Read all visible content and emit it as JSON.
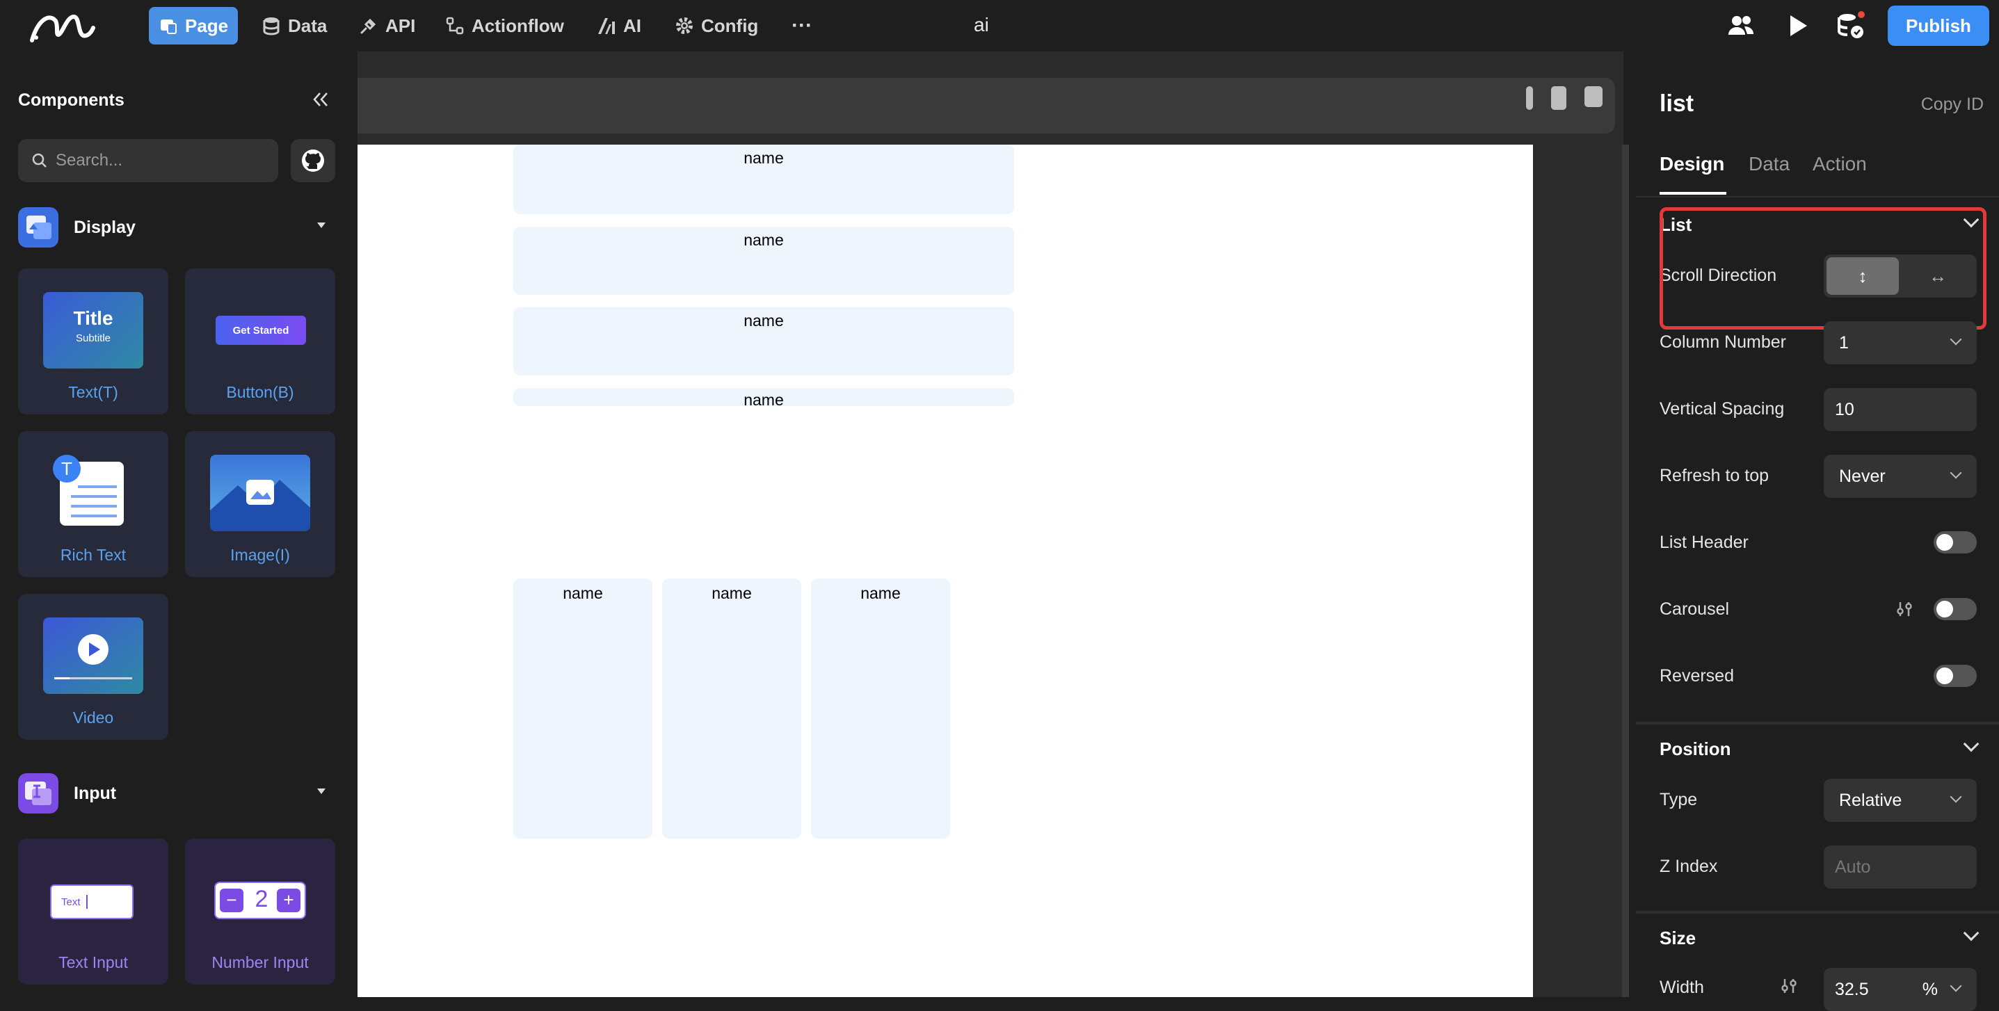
{
  "topbar": {
    "nav": [
      {
        "label": "Page",
        "icon": "page-icon",
        "active": true
      },
      {
        "label": "Data",
        "icon": "database-icon"
      },
      {
        "label": "API",
        "icon": "plug-icon"
      },
      {
        "label": "Actionflow",
        "icon": "flow-icon"
      },
      {
        "label": "AI",
        "icon": "ai-icon"
      },
      {
        "label": "Config",
        "icon": "gear-icon"
      }
    ],
    "more": "···",
    "project_name": "ai",
    "publish_label": "Publish"
  },
  "left_panel": {
    "title": "Components",
    "search_placeholder": "Search...",
    "sections": [
      {
        "label": "Display",
        "items": [
          "Text(T)",
          "Button(B)",
          "Rich Text",
          "Image(I)",
          "Video"
        ]
      },
      {
        "label": "Input",
        "items": [
          "Text Input",
          "Number Input"
        ]
      }
    ],
    "thumbs": {
      "title": "Title",
      "subtitle": "Subtitle",
      "button": "Get Started",
      "rich_badge": "T",
      "text_input": "Text",
      "number_value": "2"
    }
  },
  "canvas": {
    "vertical_list": [
      "name",
      "name",
      "name",
      "name"
    ],
    "horizontal_list": [
      "name",
      "name",
      "name"
    ]
  },
  "right_panel": {
    "title": "list",
    "copy_id": "Copy ID",
    "tabs": [
      "Design",
      "Data",
      "Action"
    ],
    "list_group": {
      "title": "List",
      "scroll_direction_label": "Scroll Direction",
      "scroll_options": [
        "↕",
        "↔"
      ],
      "column_number_label": "Column Number",
      "column_number_value": "1",
      "vertical_spacing_label": "Vertical Spacing",
      "vertical_spacing_value": "10",
      "refresh_label": "Refresh to top",
      "refresh_value": "Never",
      "list_header_label": "List Header",
      "carousel_label": "Carousel",
      "reversed_label": "Reversed"
    },
    "position_group": {
      "title": "Position",
      "type_label": "Type",
      "type_value": "Relative",
      "z_index_label": "Z Index",
      "z_index_placeholder": "Auto"
    },
    "size_group": {
      "title": "Size",
      "width_label": "Width",
      "width_value": "32.5",
      "width_unit": "%"
    }
  },
  "colors": {
    "accent": "#3b8ef3",
    "highlight": "#e23a3a",
    "list_item_bg": "#eef5fd"
  }
}
